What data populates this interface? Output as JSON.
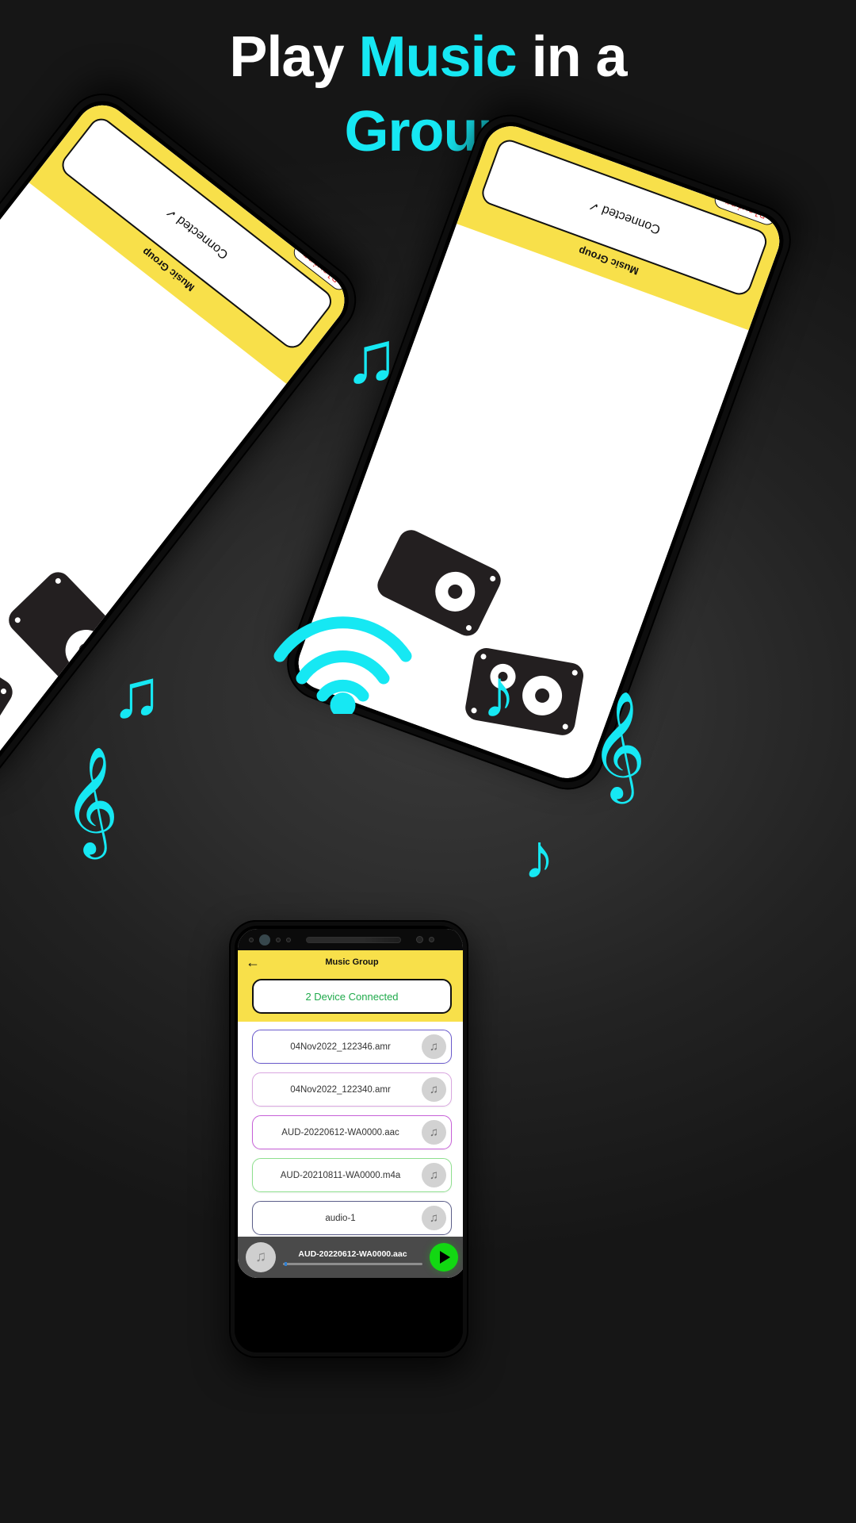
{
  "title": {
    "line1_a": "Play ",
    "line1_b": "Music",
    "line1_c": " in a",
    "line2": "Group"
  },
  "colors": {
    "accent_cyan": "#16e8f3",
    "brand_yellow": "#f8e04a",
    "connected_green": "#1faa4b",
    "play_green": "#12d812",
    "playing_red": "#e23b3b",
    "background_dark": "#2e2e2e"
  },
  "tilted_phones": [
    {
      "id": "phone-left",
      "appbar_title": "Music Group",
      "card_label": "Connected ✓",
      "badge_label": "Playing"
    },
    {
      "id": "phone-right",
      "appbar_title": "Music Group",
      "card_label": "Connected ✓",
      "badge_label": "Playing"
    }
  ],
  "center_phone": {
    "appbar": {
      "back_icon": "back-arrow-icon",
      "title": "Music Group"
    },
    "connection_status": "2 Device Connected",
    "list_items": [
      {
        "name": "04Nov2022_122346.amr",
        "border_color": "#6a5acd",
        "icon": "music-note-icon"
      },
      {
        "name": "04Nov2022_122340.amr",
        "border_color": "#d9a6e0",
        "icon": "music-note-icon"
      },
      {
        "name": "AUD-20220612-WA0000.aac",
        "border_color": "#c760d8",
        "icon": "music-note-icon"
      },
      {
        "name": "AUD-20210811-WA0000.m4a",
        "border_color": "#8fe08f",
        "icon": "music-note-icon"
      },
      {
        "name": "audio-1",
        "border_color": "#5c5f8a",
        "icon": "music-note-icon"
      },
      {
        "name": "",
        "border_color": "#e8c77a",
        "icon": "music-note-icon"
      }
    ],
    "player": {
      "thumb_icon": "music-note-icon",
      "now_playing": "AUD-20220612-WA0000.aac",
      "progress_percent": 1,
      "play_icon": "play-icon"
    }
  },
  "decorations": {
    "wifi_icon": "wifi-signal-icon",
    "notes": [
      {
        "glyph": "♫",
        "name": "beamed-note-icon"
      },
      {
        "glyph": "♫",
        "name": "beamed-note-icon"
      },
      {
        "glyph": "♪",
        "name": "eighth-note-icon"
      },
      {
        "glyph": "♪",
        "name": "eighth-note-icon"
      },
      {
        "glyph": "𝄞",
        "name": "treble-clef-icon"
      },
      {
        "glyph": "𝄞",
        "name": "treble-clef-icon"
      }
    ]
  }
}
